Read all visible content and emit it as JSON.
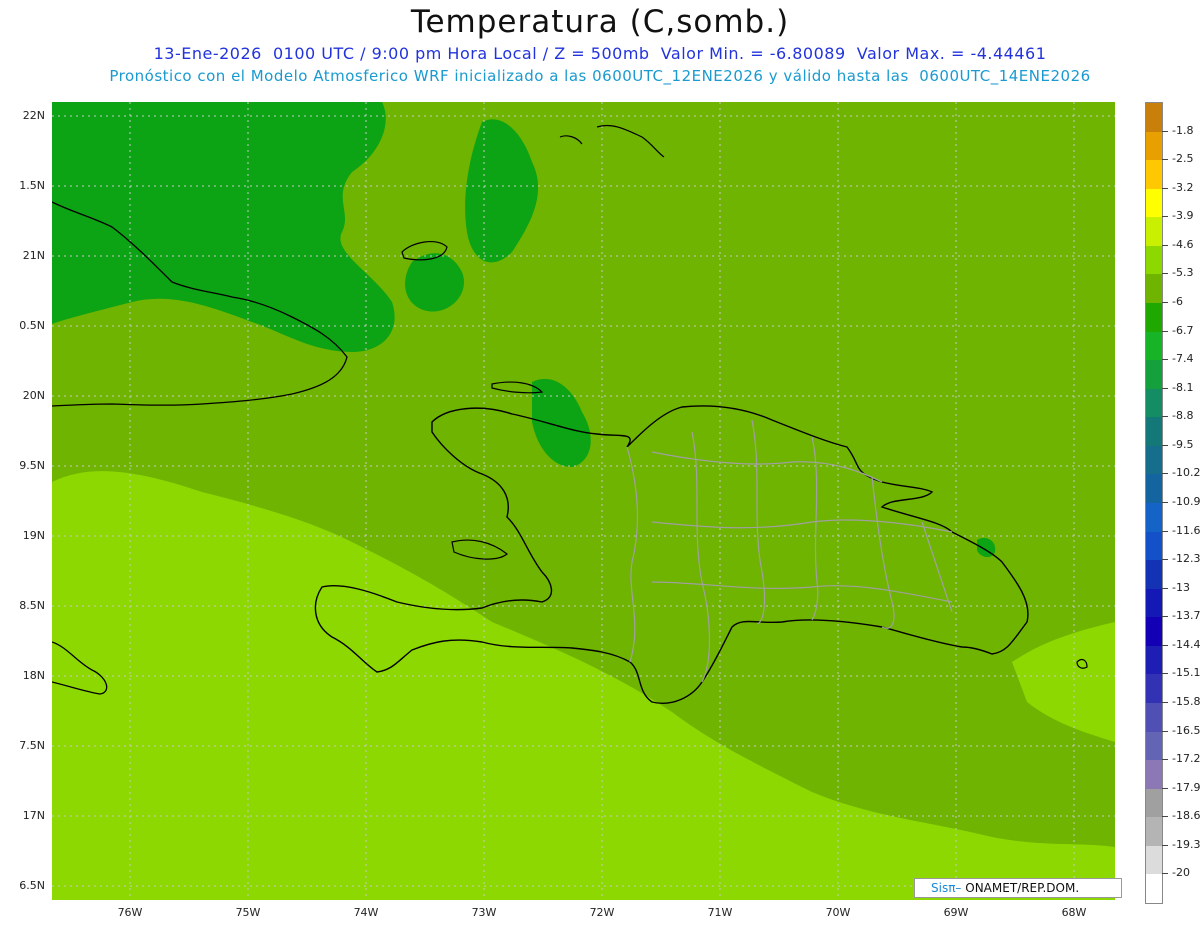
{
  "header": {
    "title": "Temperatura (C,somb.)",
    "subtitle1": "13-Ene-2026  0100 UTC / 9:00 pm Hora Local / Z = 500mb  Valor Min. = -6.80089  Valor Max. = -4.44461",
    "subtitle2": "Pronóstico con el Modelo Atmosferico WRF inicializado a las 0600UTC_12ENE2026 y válido hasta las  0600UTC_14ENE2026"
  },
  "axes": {
    "lat_labels": [
      "22N",
      "1.5N",
      "21N",
      "0.5N",
      "20N",
      "9.5N",
      "19N",
      "8.5N",
      "18N",
      "7.5N",
      "17N",
      "6.5N"
    ],
    "lat_values": [
      22,
      21.5,
      21,
      20.5,
      20,
      19.5,
      19,
      18.5,
      18,
      17.5,
      17,
      16.5
    ],
    "lon_labels": [
      "76W",
      "75W",
      "74W",
      "73W",
      "72W",
      "71W",
      "70W",
      "69W",
      "68W"
    ],
    "lon_values": [
      -76,
      -75,
      -74,
      -73,
      -72,
      -71,
      -70,
      -69,
      -68
    ],
    "lat_range": [
      16.4,
      22.1
    ],
    "lon_range": [
      -76.65,
      -67.65
    ]
  },
  "colorbar": {
    "labels": [
      "-1.8",
      "-2.5",
      "-3.2",
      "-3.9",
      "-4.6",
      "-5.3",
      "-6",
      "-6.7",
      "-7.4",
      "-8.1",
      "-8.8",
      "-9.5",
      "-10.2",
      "-10.9",
      "-11.6",
      "-12.3",
      "-13",
      "-13.7",
      "-14.4",
      "-15.1",
      "-15.8",
      "-16.5",
      "-17.2",
      "-17.9",
      "-18.6",
      "-19.3",
      "-20"
    ],
    "colors": [
      "#c8800a",
      "#e8a000",
      "#ffc800",
      "#ffff00",
      "#c8f000",
      "#8cd800",
      "#6eb400",
      "#1ea800",
      "#18b428",
      "#14a03c",
      "#148c64",
      "#147878",
      "#146e8c",
      "#1464a0",
      "#1464c8",
      "#1450c8",
      "#1432b4",
      "#1418b4",
      "#1400b4",
      "#1e1eb4",
      "#3232b4",
      "#5050b4",
      "#6464b4",
      "#8c78b4",
      "#a0a0a0",
      "#b4b4b4",
      "#dcdcdc",
      "#ffffff"
    ]
  },
  "legend_field": {
    "base_color": "#6eb400",
    "warm_color": "#8cd800",
    "cool_color": "#0ca314",
    "coast_color": "#000000",
    "province_color": "#a0a0a0",
    "grid_color": "#c8c8c8"
  },
  "logo": {
    "brand": "Sisπ–",
    "text": " ONAMET/REP.DOM."
  }
}
